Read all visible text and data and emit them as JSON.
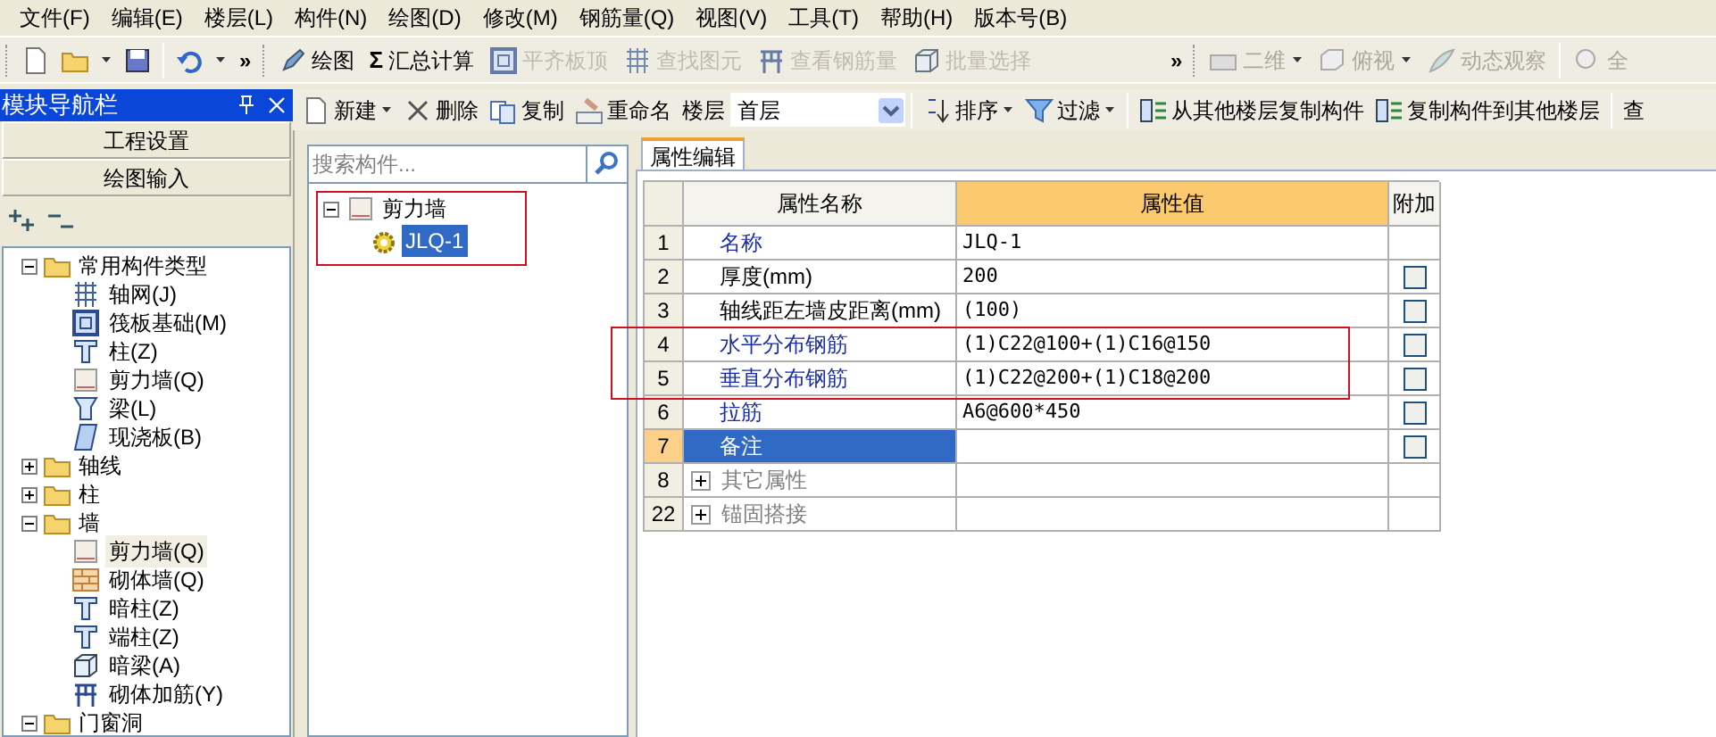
{
  "menu_bar": [
    "文件(F)",
    "编辑(E)",
    "楼层(L)",
    "构件(N)",
    "绘图(D)",
    "修改(M)",
    "钢筋量(Q)",
    "视图(V)",
    "工具(T)",
    "帮助(H)",
    "版本号(B)"
  ],
  "main_toolbar": {
    "overflow_1": "»",
    "items": [
      {
        "label": "绘图",
        "disabled": false
      },
      {
        "label": "汇总计算",
        "symbol": "Σ",
        "disabled": false
      },
      {
        "label": "平齐板顶",
        "disabled": true
      },
      {
        "label": "查找图元",
        "disabled": true
      },
      {
        "label": "查看钢筋量",
        "disabled": true
      },
      {
        "label": "批量选择",
        "disabled": true
      }
    ],
    "overflow_2": "»",
    "view_items": [
      {
        "label": "二维",
        "dropdown": true,
        "disabled": true
      },
      {
        "label": "俯视",
        "dropdown": true,
        "disabled": true
      },
      {
        "label": "动态观察",
        "dropdown": false,
        "disabled": true
      },
      {
        "label": "全",
        "dropdown": false,
        "disabled": true
      }
    ]
  },
  "navigator": {
    "title": "模块导航栏",
    "buttons": [
      "工程设置",
      "绘图输入"
    ],
    "tree": [
      {
        "label": "常用构件类型",
        "expanded": true,
        "selected": false,
        "children": [
          {
            "label": "轴网(J)",
            "selected": false
          },
          {
            "label": "筏板基础(M)",
            "selected": false
          },
          {
            "label": "柱(Z)",
            "selected": false
          },
          {
            "label": "剪力墙(Q)",
            "selected": false
          },
          {
            "label": "梁(L)",
            "selected": false
          },
          {
            "label": "现浇板(B)",
            "selected": false
          }
        ]
      },
      {
        "label": "轴线",
        "expanded": false,
        "selected": false
      },
      {
        "label": "柱",
        "expanded": false,
        "selected": false
      },
      {
        "label": "墙",
        "expanded": true,
        "selected": false,
        "children": [
          {
            "label": "剪力墙(Q)",
            "selected": true
          },
          {
            "label": "砌体墙(Q)",
            "selected": false
          },
          {
            "label": "暗柱(Z)",
            "selected": false
          },
          {
            "label": "端柱(Z)",
            "selected": false
          },
          {
            "label": "暗梁(A)",
            "selected": false
          },
          {
            "label": "砌体加筋(Y)",
            "selected": false
          }
        ]
      },
      {
        "label": "门窗洞",
        "expanded": true,
        "selected": false
      }
    ]
  },
  "component_toolbar": [
    {
      "kind": "button",
      "label": "新建",
      "dropdown": true
    },
    {
      "kind": "button",
      "label": "删除",
      "dropdown": false
    },
    {
      "kind": "button",
      "label": "复制",
      "dropdown": false
    },
    {
      "kind": "button",
      "label": "重命名",
      "dropdown": false
    },
    {
      "kind": "label",
      "label": "楼层"
    },
    {
      "kind": "select",
      "label": "首层"
    },
    {
      "kind": "button",
      "label": "排序",
      "dropdown": true
    },
    {
      "kind": "button",
      "label": "过滤",
      "dropdown": true
    },
    {
      "kind": "button",
      "label": "从其他楼层复制构件",
      "dropdown": false
    },
    {
      "kind": "button",
      "label": "复制构件到其他楼层",
      "dropdown": false
    },
    {
      "kind": "button",
      "label": "查",
      "dropdown": false
    }
  ],
  "component_list": {
    "search": {
      "placeholder": "搜索构件..."
    },
    "tree": [
      {
        "label": "剪力墙",
        "expanded": true,
        "highlighted": true,
        "children": [
          {
            "label": "JLQ-1",
            "selected": true
          }
        ]
      }
    ]
  },
  "property_editor": {
    "tab": "属性编辑",
    "columns": [
      "属性名称",
      "属性值",
      "附加"
    ],
    "rows": [
      {
        "kind": "property",
        "number": "1",
        "name": "名称",
        "value": "JLQ-1",
        "emphasized": true,
        "selected": false
      },
      {
        "kind": "property",
        "number": "2",
        "name": "厚度(mm)",
        "value": "200",
        "emphasized": false,
        "selected": false,
        "checked": false
      },
      {
        "kind": "property",
        "number": "3",
        "name": "轴线距左墙皮距离(mm)",
        "value": "(100)",
        "emphasized": false,
        "selected": false,
        "checked": false
      },
      {
        "kind": "property",
        "number": "4",
        "name": "水平分布钢筋",
        "value": "(1)C22@100+(1)C16@150",
        "emphasized": true,
        "selected": false,
        "highlighted": true,
        "checked": false
      },
      {
        "kind": "property",
        "number": "5",
        "name": "垂直分布钢筋",
        "value": "(1)C22@200+(1)C18@200",
        "emphasized": true,
        "selected": false,
        "highlighted": true,
        "checked": false
      },
      {
        "kind": "property",
        "number": "6",
        "name": "拉筋",
        "value": "A6@600*450",
        "emphasized": true,
        "selected": false,
        "checked": false
      },
      {
        "kind": "property",
        "number": "7",
        "name": "备注",
        "value": "",
        "emphasized": true,
        "selected": true,
        "checked": false
      },
      {
        "kind": "group",
        "number": "8",
        "name": "其它属性",
        "expanded": false
      },
      {
        "kind": "group",
        "number": "22",
        "name": "锚固搭接",
        "expanded": false
      }
    ]
  }
}
